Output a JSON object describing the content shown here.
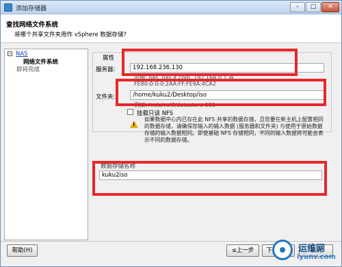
{
  "window": {
    "title": "添加存储器",
    "controls": {
      "minimize": "–",
      "maximize": "□",
      "close": "✕"
    }
  },
  "header": {
    "title": "查找网络文件系统",
    "subtitle": "将哪个共享文件夹用作 vSphere 数据存储?"
  },
  "nav": {
    "items": [
      {
        "label": "NAS",
        "state": "link"
      },
      {
        "label": "网络文件系统",
        "state": "current"
      },
      {
        "label": "即将完成",
        "state": "pending"
      }
    ]
  },
  "properties": {
    "group_label": "属性",
    "server_label": "服务器:",
    "server_value": "192.168.236.130",
    "server_hint_line1": "示例: nas, nas.it.com, 192.168.0.1 或",
    "server_hint_line2": "FE80:0:0:0:2AA:FF:FE9A:4CA2",
    "folder_label": "文件夹:",
    "folder_value": "/home/kuku2/Desktop/iso",
    "folder_hint": "例如: /vols/vol0/datastore-001",
    "readonly_label": "挂载只读 NFS",
    "readonly_checked": false,
    "warning_text": "如果数据中心内已存在此 NFS 共享的数据存储，且您要在新主机上配置相同的数据存储，请确保您输入的输入数据 (服务器和文件夹) 与使用于原始数据存储的输入数据相同。即使基础 NFS 存储相同，不同的输入数据将可能会表示不同的数据存储。"
  },
  "datastore": {
    "name_label": "数据存储名称",
    "name_value": "kuku2iso"
  },
  "buttons": {
    "help": "帮助(H)",
    "back": "≤上一步",
    "next": "下一步 ≥",
    "cancel": "取消"
  },
  "watermark": {
    "cn": "运维网",
    "url": "iyunv.com"
  },
  "colors": {
    "highlight_box": "#e8262b",
    "titlebar": "#bcd2ec",
    "link": "#0b44b4"
  }
}
